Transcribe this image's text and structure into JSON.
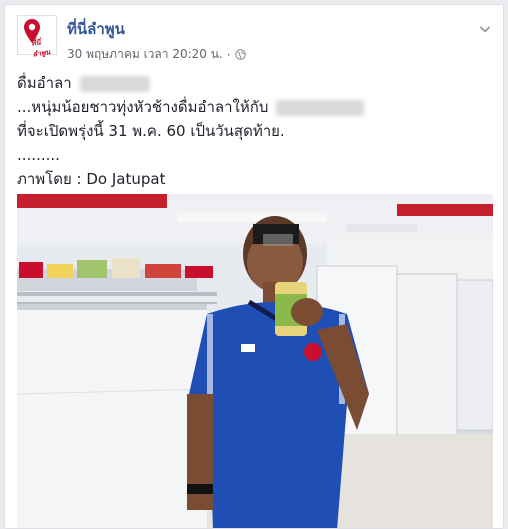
{
  "post": {
    "page_name": "ที่นี่ลำพูน",
    "timestamp": "30 พฤษภาคม เวลา 20:20 น.",
    "separator": "·",
    "avatar_brand": "ที่นี่ลำพูน",
    "lines": {
      "l1": "ดื่มอำลา",
      "l2": "...หนุ่มน้อยชาวทุ่งหัวช้างดื่มอำลาให้กับ",
      "l3": "ที่จะเปิดพรุ่งนี้ 31 พ.ค. 60 เป็นวันสุดท้าย.",
      "l4": ".........",
      "l5": "ภาพโดย : Do Jatupat"
    }
  },
  "colors": {
    "link": "#365899",
    "meta": "#616770",
    "text": "#1d2129",
    "brand_red": "#c8102e",
    "jersey_blue": "#1f4fb5"
  },
  "icons": {
    "globe": "globe-icon",
    "options": "chevron-down-icon",
    "avatar_pin": "map-pin-icon"
  }
}
